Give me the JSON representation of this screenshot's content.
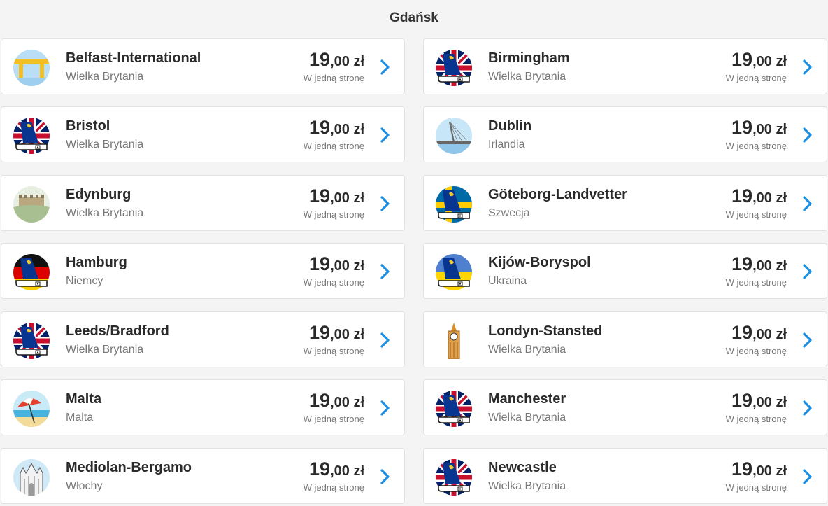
{
  "origin": "Gdańsk",
  "currency": "zł",
  "oneway_label": "W jedną stronę",
  "colors": {
    "chevron": "#1a8fe3",
    "text_dark": "#2a2a2a",
    "text_muted": "#777777",
    "ryanair_blue": "#073590",
    "ryanair_yellow": "#f1c933"
  },
  "routes": [
    {
      "city": "Belfast-International",
      "country": "Wielka Brytania",
      "price_int": "19",
      "price_dec": ",00",
      "icon": "shipyard-crane-icon"
    },
    {
      "city": "Birmingham",
      "country": "Wielka Brytania",
      "price_int": "19",
      "price_dec": ",00",
      "icon": "ryanair-uk-flag-icon"
    },
    {
      "city": "Bristol",
      "country": "Wielka Brytania",
      "price_int": "19",
      "price_dec": ",00",
      "icon": "ryanair-uk-flag-icon"
    },
    {
      "city": "Dublin",
      "country": "Irlandia",
      "price_int": "19",
      "price_dec": ",00",
      "icon": "dublin-bridge-icon"
    },
    {
      "city": "Edynburg",
      "country": "Wielka Brytania",
      "price_int": "19",
      "price_dec": ",00",
      "icon": "edinburgh-castle-icon"
    },
    {
      "city": "Göteborg-Landvetter",
      "country": "Szwecja",
      "price_int": "19",
      "price_dec": ",00",
      "icon": "ryanair-sweden-flag-icon"
    },
    {
      "city": "Hamburg",
      "country": "Niemcy",
      "price_int": "19",
      "price_dec": ",00",
      "icon": "ryanair-germany-flag-icon"
    },
    {
      "city": "Kijów-Boryspol",
      "country": "Ukraina",
      "price_int": "19",
      "price_dec": ",00",
      "icon": "ryanair-ukraine-flag-icon"
    },
    {
      "city": "Leeds/Bradford",
      "country": "Wielka Brytania",
      "price_int": "19",
      "price_dec": ",00",
      "icon": "ryanair-uk-flag-icon"
    },
    {
      "city": "Londyn-Stansted",
      "country": "Wielka Brytania",
      "price_int": "19",
      "price_dec": ",00",
      "icon": "big-ben-icon"
    },
    {
      "city": "Malta",
      "country": "Malta",
      "price_int": "19",
      "price_dec": ",00",
      "icon": "beach-umbrella-icon"
    },
    {
      "city": "Manchester",
      "country": "Wielka Brytania",
      "price_int": "19",
      "price_dec": ",00",
      "icon": "ryanair-uk-flag-icon"
    },
    {
      "city": "Mediolan-Bergamo",
      "country": "Włochy",
      "price_int": "19",
      "price_dec": ",00",
      "icon": "milan-cathedral-icon"
    },
    {
      "city": "Newcastle",
      "country": "Wielka Brytania",
      "price_int": "19",
      "price_dec": ",00",
      "icon": "ryanair-uk-flag-icon"
    }
  ]
}
